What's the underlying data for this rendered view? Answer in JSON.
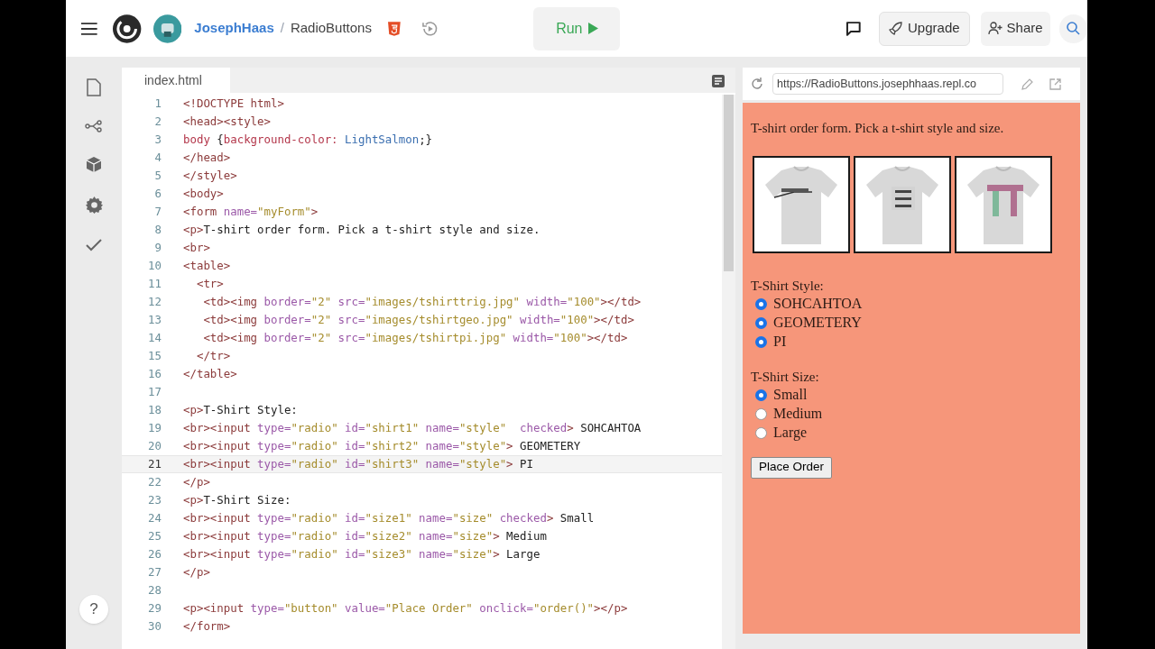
{
  "topbar": {
    "user": "JosephHaas",
    "separator": "/",
    "project": "RadioButtons",
    "run_label": "Run",
    "upgrade_label": "Upgrade",
    "share_label": "Share"
  },
  "rail": {
    "help": "?"
  },
  "editor": {
    "tab": "index.html",
    "lines": [
      {
        "number": "1",
        "current": false,
        "tokens": [
          {
            "kind": "tag",
            "text": "<!DOCTYPE html>"
          }
        ]
      },
      {
        "number": "2",
        "current": false,
        "tokens": [
          {
            "kind": "tag",
            "text": "<head><style>"
          }
        ]
      },
      {
        "number": "3",
        "current": false,
        "tokens": [
          {
            "kind": "prop",
            "text": "body"
          },
          {
            "kind": "text",
            "text": " {"
          },
          {
            "kind": "prop",
            "text": "background-color:"
          },
          {
            "kind": "val",
            "text": " LightSalmon"
          },
          {
            "kind": "text",
            "text": ";}"
          }
        ]
      },
      {
        "number": "4",
        "current": false,
        "tokens": [
          {
            "kind": "tag",
            "text": "</head>"
          }
        ]
      },
      {
        "number": "5",
        "current": false,
        "tokens": [
          {
            "kind": "tag",
            "text": "</style>"
          }
        ]
      },
      {
        "number": "6",
        "current": false,
        "tokens": [
          {
            "kind": "tag",
            "text": "<body>"
          }
        ]
      },
      {
        "number": "7",
        "current": false,
        "tokens": [
          {
            "kind": "tag",
            "text": "<form"
          },
          {
            "kind": "attr",
            "text": " name="
          },
          {
            "kind": "str",
            "text": "\"myForm\""
          },
          {
            "kind": "tag",
            "text": ">"
          }
        ]
      },
      {
        "number": "8",
        "current": false,
        "tokens": [
          {
            "kind": "tag",
            "text": "<p>"
          },
          {
            "kind": "text",
            "text": "T-shirt order form. Pick a t-shirt style and size."
          }
        ]
      },
      {
        "number": "9",
        "current": false,
        "tokens": [
          {
            "kind": "tag",
            "text": "<br>"
          }
        ]
      },
      {
        "number": "10",
        "current": false,
        "tokens": [
          {
            "kind": "tag",
            "text": "<table>"
          }
        ]
      },
      {
        "number": "11",
        "current": false,
        "tokens": [
          {
            "kind": "tag",
            "text": "  <tr>"
          }
        ]
      },
      {
        "number": "12",
        "current": false,
        "tokens": [
          {
            "kind": "tag",
            "text": "   <td><img"
          },
          {
            "kind": "attr",
            "text": " border="
          },
          {
            "kind": "str",
            "text": "\"2\""
          },
          {
            "kind": "attr",
            "text": " src="
          },
          {
            "kind": "str",
            "text": "\"images/tshirttrig.jpg\""
          },
          {
            "kind": "attr",
            "text": " width="
          },
          {
            "kind": "str",
            "text": "\"100\""
          },
          {
            "kind": "tag",
            "text": "></td>"
          }
        ]
      },
      {
        "number": "13",
        "current": false,
        "tokens": [
          {
            "kind": "tag",
            "text": "   <td><img"
          },
          {
            "kind": "attr",
            "text": " border="
          },
          {
            "kind": "str",
            "text": "\"2\""
          },
          {
            "kind": "attr",
            "text": " src="
          },
          {
            "kind": "str",
            "text": "\"images/tshirtgeo.jpg\""
          },
          {
            "kind": "attr",
            "text": " width="
          },
          {
            "kind": "str",
            "text": "\"100\""
          },
          {
            "kind": "tag",
            "text": "></td>"
          }
        ]
      },
      {
        "number": "14",
        "current": false,
        "tokens": [
          {
            "kind": "tag",
            "text": "   <td><img"
          },
          {
            "kind": "attr",
            "text": " border="
          },
          {
            "kind": "str",
            "text": "\"2\""
          },
          {
            "kind": "attr",
            "text": " src="
          },
          {
            "kind": "str",
            "text": "\"images/tshirtpi.jpg\""
          },
          {
            "kind": "attr",
            "text": " width="
          },
          {
            "kind": "str",
            "text": "\"100\""
          },
          {
            "kind": "tag",
            "text": "></td>"
          }
        ]
      },
      {
        "number": "15",
        "current": false,
        "tokens": [
          {
            "kind": "tag",
            "text": "  </tr>"
          }
        ]
      },
      {
        "number": "16",
        "current": false,
        "tokens": [
          {
            "kind": "tag",
            "text": "</table>"
          }
        ]
      },
      {
        "number": "17",
        "current": false
      },
      {
        "number": "18",
        "current": false,
        "tokens": [
          {
            "kind": "tag",
            "text": "<p>"
          },
          {
            "kind": "text",
            "text": "T-Shirt Style:"
          }
        ]
      },
      {
        "number": "19",
        "current": false,
        "tokens": [
          {
            "kind": "tag",
            "text": "<br><input"
          },
          {
            "kind": "attr",
            "text": " type="
          },
          {
            "kind": "str",
            "text": "\"radio\""
          },
          {
            "kind": "attr",
            "text": " id="
          },
          {
            "kind": "str",
            "text": "\"shirt1\""
          },
          {
            "kind": "attr",
            "text": " name="
          },
          {
            "kind": "str",
            "text": "\"style\""
          },
          {
            "kind": "attr",
            "text": "  checked"
          },
          {
            "kind": "tag",
            "text": ">"
          },
          {
            "kind": "text",
            "text": " SOHCAHTOA"
          }
        ]
      },
      {
        "number": "20",
        "current": false,
        "tokens": [
          {
            "kind": "tag",
            "text": "<br><input"
          },
          {
            "kind": "attr",
            "text": " type="
          },
          {
            "kind": "str",
            "text": "\"radio\""
          },
          {
            "kind": "attr",
            "text": " id="
          },
          {
            "kind": "str",
            "text": "\"shirt2\""
          },
          {
            "kind": "attr",
            "text": " name="
          },
          {
            "kind": "str",
            "text": "\"style\""
          },
          {
            "kind": "tag",
            "text": ">"
          },
          {
            "kind": "text",
            "text": " GEOMETERY"
          }
        ]
      },
      {
        "number": "21",
        "current": true,
        "tokens": [
          {
            "kind": "tag",
            "text": "<br><input"
          },
          {
            "kind": "attr",
            "text": " type="
          },
          {
            "kind": "str",
            "text": "\"radio\""
          },
          {
            "kind": "attr",
            "text": " id="
          },
          {
            "kind": "str",
            "text": "\"shirt3\""
          },
          {
            "kind": "attr",
            "text": " name="
          },
          {
            "kind": "str",
            "text": "\"style\""
          },
          {
            "kind": "tag",
            "text": ">"
          },
          {
            "kind": "text",
            "text": " PI"
          }
        ]
      },
      {
        "number": "22",
        "current": false,
        "tokens": [
          {
            "kind": "tag",
            "text": "</p>"
          }
        ]
      },
      {
        "number": "23",
        "current": false,
        "tokens": [
          {
            "kind": "tag",
            "text": "<p>"
          },
          {
            "kind": "text",
            "text": "T-Shirt Size:"
          }
        ]
      },
      {
        "number": "24",
        "current": false,
        "tokens": [
          {
            "kind": "tag",
            "text": "<br><input"
          },
          {
            "kind": "attr",
            "text": " type="
          },
          {
            "kind": "str",
            "text": "\"radio\""
          },
          {
            "kind": "attr",
            "text": " id="
          },
          {
            "kind": "str",
            "text": "\"size1\""
          },
          {
            "kind": "attr",
            "text": " name="
          },
          {
            "kind": "str",
            "text": "\"size\""
          },
          {
            "kind": "attr",
            "text": " checked"
          },
          {
            "kind": "tag",
            "text": ">"
          },
          {
            "kind": "text",
            "text": " Small"
          }
        ]
      },
      {
        "number": "25",
        "current": false,
        "tokens": [
          {
            "kind": "tag",
            "text": "<br><input"
          },
          {
            "kind": "attr",
            "text": " type="
          },
          {
            "kind": "str",
            "text": "\"radio\""
          },
          {
            "kind": "attr",
            "text": " id="
          },
          {
            "kind": "str",
            "text": "\"size2\""
          },
          {
            "kind": "attr",
            "text": " name="
          },
          {
            "kind": "str",
            "text": "\"size\""
          },
          {
            "kind": "tag",
            "text": ">"
          },
          {
            "kind": "text",
            "text": " Medium"
          }
        ]
      },
      {
        "number": "26",
        "current": false,
        "tokens": [
          {
            "kind": "tag",
            "text": "<br><input"
          },
          {
            "kind": "attr",
            "text": " type="
          },
          {
            "kind": "str",
            "text": "\"radio\""
          },
          {
            "kind": "attr",
            "text": " id="
          },
          {
            "kind": "str",
            "text": "\"size3\""
          },
          {
            "kind": "attr",
            "text": " name="
          },
          {
            "kind": "str",
            "text": "\"size\""
          },
          {
            "kind": "tag",
            "text": ">"
          },
          {
            "kind": "text",
            "text": " Large"
          }
        ]
      },
      {
        "number": "27",
        "current": false,
        "tokens": [
          {
            "kind": "tag",
            "text": "</p>"
          }
        ]
      },
      {
        "number": "28",
        "current": false
      },
      {
        "number": "29",
        "current": false,
        "tokens": [
          {
            "kind": "tag",
            "text": "<p><input"
          },
          {
            "kind": "attr",
            "text": " type="
          },
          {
            "kind": "str",
            "text": "\"button\""
          },
          {
            "kind": "attr",
            "text": " value="
          },
          {
            "kind": "str",
            "text": "\"Place Order\""
          },
          {
            "kind": "attr",
            "text": " onclick="
          },
          {
            "kind": "str",
            "text": "\"order()\""
          },
          {
            "kind": "tag",
            "text": "></p>"
          }
        ]
      },
      {
        "number": "30",
        "current": false,
        "tokens": [
          {
            "kind": "tag",
            "text": "</form>"
          }
        ]
      }
    ]
  },
  "preview": {
    "url": "https://RadioButtons.josephhaas.repl.co",
    "intro": "T-shirt order form. Pick a t-shirt style and size.",
    "groups": [
      {
        "label": "T-Shirt Style:",
        "options": [
          {
            "label": "SOHCAHTOA",
            "selected": true
          },
          {
            "label": "GEOMETERY",
            "selected": true
          },
          {
            "label": "PI",
            "selected": true
          }
        ]
      },
      {
        "label": "T-Shirt Size:",
        "options": [
          {
            "label": "Small",
            "selected": true
          },
          {
            "label": "Medium",
            "selected": false
          },
          {
            "label": "Large",
            "selected": false
          }
        ]
      }
    ],
    "button": "Place Order"
  }
}
